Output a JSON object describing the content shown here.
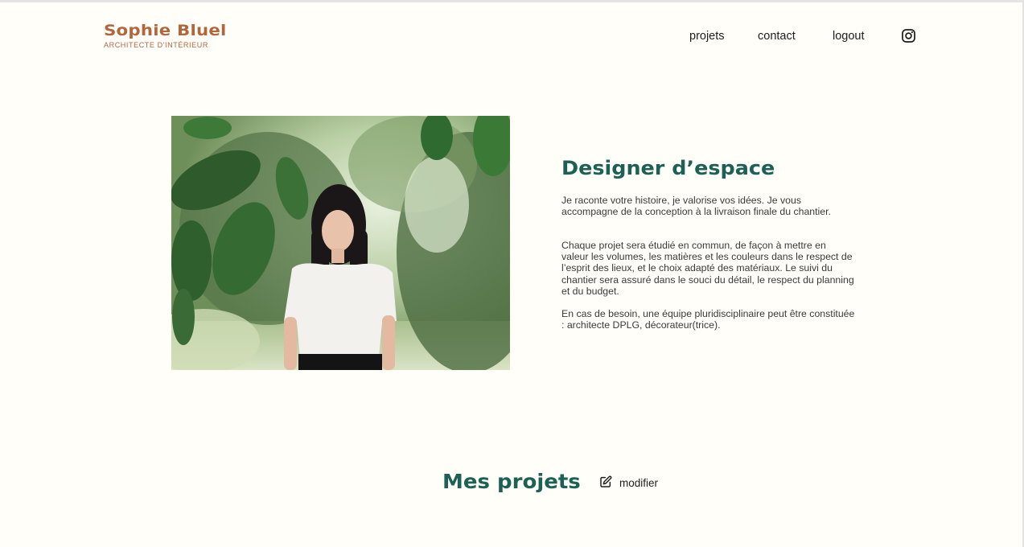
{
  "header": {
    "logo_name": "Sophie Bluel",
    "logo_subtitle": "ARCHITECTE D'INTÉRIEUR",
    "nav": {
      "projets": "projets",
      "contact": "contact",
      "logout": "logout"
    },
    "social_icon": "instagram-icon"
  },
  "introduction": {
    "title": "Designer d’espace",
    "paragraphs": [
      "Je raconte votre histoire, je valorise vos idées. Je vous accompagne de la conception à la livraison finale du chantier.",
      "Chaque projet sera étudié en commun, de façon à mettre en valeur les volumes, les matières et les couleurs dans le respect de l’esprit des lieux, et le choix adapté des matériaux. Le suivi du chantier sera assuré dans le souci du détail, le respect du planning et du budget.",
      "En cas de besoin, une équipe pluridisciplinaire peut être constituée : architecte DPLG, décorateur(trice)."
    ]
  },
  "portfolio": {
    "title": "Mes projets",
    "edit_label": "modifier",
    "edit_icon": "edit-icon"
  },
  "colors": {
    "brand": "#b1663c",
    "accent": "#1d6154",
    "background": "#fffef8"
  }
}
